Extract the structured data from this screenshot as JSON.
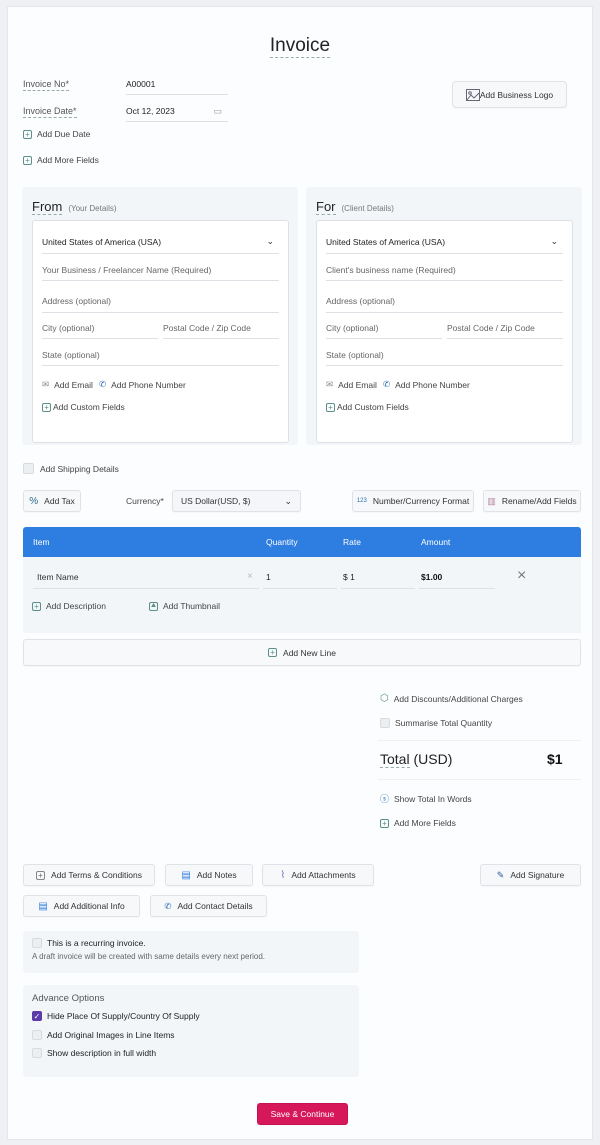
{
  "title": "Invoice",
  "header": {
    "invoice_no_label": "Invoice No*",
    "invoice_no_value": "A00001",
    "invoice_date_label": "Invoice Date*",
    "invoice_date_value": "Oct 12, 2023",
    "add_due_date": "Add Due Date",
    "add_more_fields": "Add More Fields",
    "add_logo": "Add Business Logo"
  },
  "from": {
    "title": "From",
    "subtitle": "(Your Details)",
    "country": "United States of America (USA)",
    "name_placeholder": "Your Business / Freelancer Name (Required)",
    "address_placeholder": "Address (optional)",
    "city_placeholder": "City (optional)",
    "postal_placeholder": "Postal Code / Zip Code",
    "state_placeholder": "State (optional)",
    "add_email": "Add Email",
    "add_phone": "Add Phone Number",
    "add_custom": "Add Custom Fields"
  },
  "for": {
    "title": "For",
    "subtitle": "(Client Details)",
    "country": "United States of America (USA)",
    "name_placeholder": "Client's business name (Required)",
    "address_placeholder": "Address (optional)",
    "city_placeholder": "City (optional)",
    "postal_placeholder": "Postal Code / Zip Code",
    "state_placeholder": "State (optional)",
    "add_email": "Add Email",
    "add_phone": "Add Phone Number",
    "add_custom": "Add Custom Fields"
  },
  "shipping": {
    "label": "Add Shipping Details",
    "checked": false
  },
  "toolbar": {
    "add_tax": "Add Tax",
    "currency_label": "Currency*",
    "currency_value": "US Dollar(USD, $)",
    "number_format": "Number/Currency Format",
    "number_format_icon": "123",
    "rename_fields": "Rename/Add Fields"
  },
  "table": {
    "columns": [
      "Item",
      "Quantity",
      "Rate",
      "Amount"
    ],
    "header_color": "#2e7de0",
    "rows": [
      {
        "item": "Item Name",
        "quantity": "1",
        "rate": "$ 1",
        "amount": "$1.00"
      }
    ],
    "add_description": "Add Description",
    "add_thumbnail": "Add Thumbnail",
    "add_new_line": "Add New Line"
  },
  "summary": {
    "add_discounts": "Add Discounts/Additional Charges",
    "summarise_qty": "Summarise Total Quantity",
    "total_label": "Total",
    "total_currency": "(USD)",
    "total_value": "$1",
    "show_words": "Show Total In Words",
    "add_more_fields": "Add More Fields"
  },
  "actions": {
    "terms": "Add Terms & Conditions",
    "notes": "Add Notes",
    "attachments": "Add Attachments",
    "signature": "Add Signature",
    "additional_info": "Add Additional Info",
    "contact_details": "Add Contact Details"
  },
  "recurring": {
    "label": "This is a recurring invoice.",
    "hint": "A draft invoice will be created with same details every next period.",
    "checked": false
  },
  "advance": {
    "title": "Advance Options",
    "options": [
      {
        "label": "Hide Place Of Supply/Country Of Supply",
        "checked": true
      },
      {
        "label": "Add Original Images in Line Items",
        "checked": false
      },
      {
        "label": "Show description in full width",
        "checked": false
      }
    ]
  },
  "save_button": {
    "label": "Save & Continue",
    "color": "#d6185a"
  }
}
